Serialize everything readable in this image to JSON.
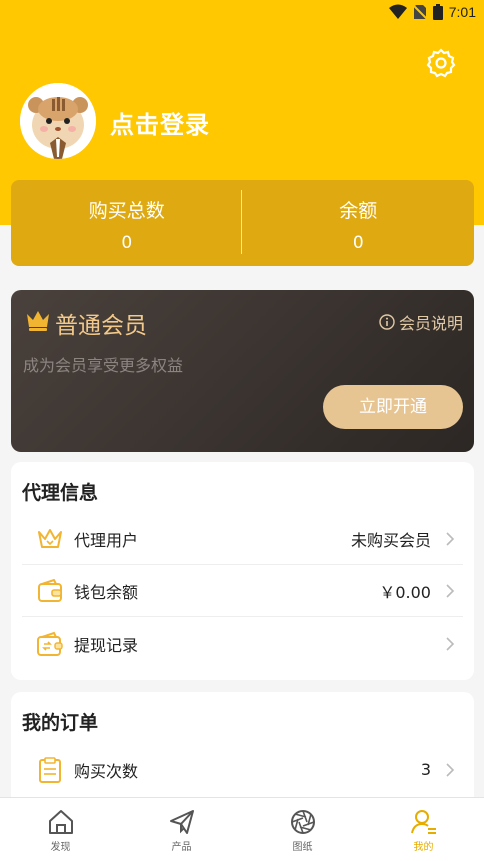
{
  "status_bar": {
    "time": "7:01"
  },
  "profile": {
    "login_text": "点击登录"
  },
  "stats": [
    {
      "label": "购买总数",
      "value": "0"
    },
    {
      "label": "余额",
      "value": "0"
    }
  ],
  "vip": {
    "title": "普通会员",
    "explain": "会员说明",
    "subtitle": "成为会员享受更多权益",
    "button": "立即开通"
  },
  "agent": {
    "title": "代理信息",
    "rows": [
      {
        "icon": "crown-icon",
        "label": "代理用户",
        "value": "未购买会员"
      },
      {
        "icon": "wallet-icon",
        "label": "钱包余额",
        "value": "￥0.00"
      },
      {
        "icon": "withdraw-icon",
        "label": "提现记录",
        "value": ""
      }
    ]
  },
  "orders": {
    "title": "我的订单",
    "rows": [
      {
        "icon": "clipboard-icon",
        "label": "购买次数",
        "value": "3"
      }
    ]
  },
  "tabs": [
    {
      "label": "发现",
      "icon": "home-icon",
      "active": false
    },
    {
      "label": "产品",
      "icon": "paper-plane-icon",
      "active": false
    },
    {
      "label": "图纸",
      "icon": "aperture-icon",
      "active": false
    },
    {
      "label": "我的",
      "icon": "user-icon",
      "active": true
    }
  ],
  "colors": {
    "brand": "#ffc800",
    "stats_bg": "#dfa911",
    "vip_gold": "#e7c593",
    "active_tab": "#e6ad00"
  }
}
